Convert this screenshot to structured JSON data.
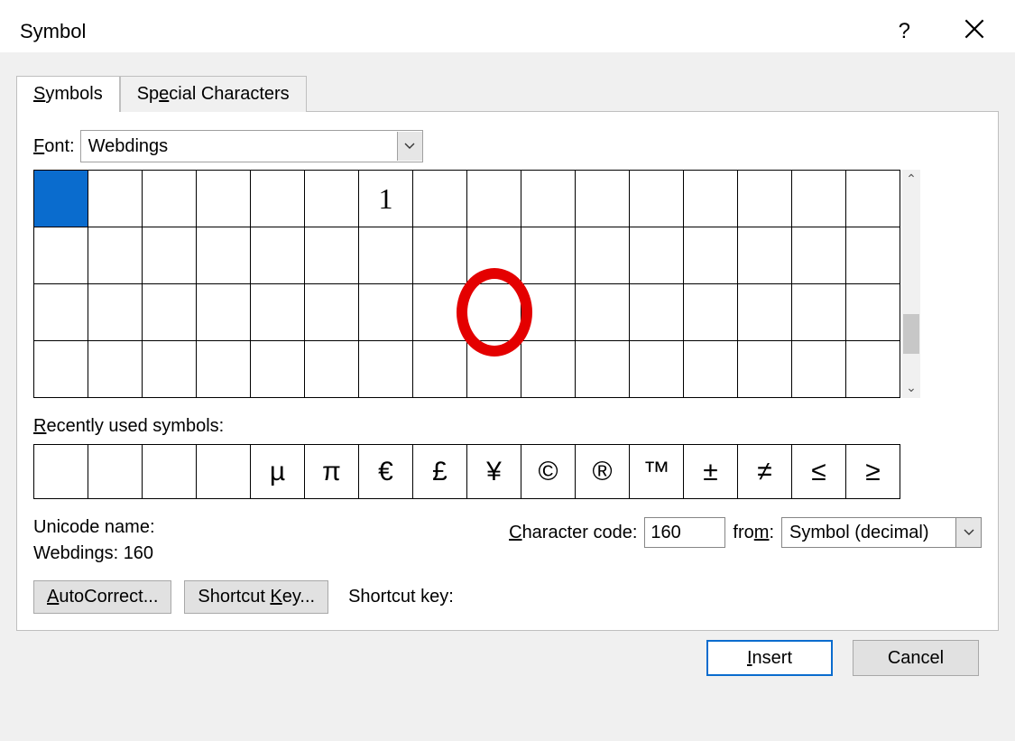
{
  "title": "Symbol",
  "titlebar": {
    "help": "?",
    "close": "×"
  },
  "tabs": {
    "symbols": "Symbols",
    "special": "Special Characters"
  },
  "font": {
    "label": "Font:",
    "value": "Webdings"
  },
  "grid": {
    "rows": [
      [
        "",
        "",
        "",
        "",
        "",
        "",
        "1",
        "",
        "",
        "",
        "",
        "",
        "",
        "",
        "",
        ""
      ],
      [
        "",
        "",
        "",
        "",
        "",
        "",
        "",
        "",
        "",
        "",
        "",
        "",
        "",
        "",
        "",
        ""
      ],
      [
        "",
        "",
        "",
        "",
        "",
        "",
        "",
        "",
        "",
        "",
        "",
        "",
        "",
        "",
        "",
        ""
      ],
      [
        "",
        "",
        "",
        "",
        "",
        "",
        "",
        "",
        "",
        "",
        "",
        "",
        "",
        "",
        "",
        ""
      ]
    ],
    "selected": {
      "r": 0,
      "c": 0
    },
    "circled": {
      "r": 2,
      "c": 8
    }
  },
  "recent": {
    "label": "Recently used symbols:",
    "cells": [
      {
        "t": "",
        "cls": "wd"
      },
      {
        "t": "",
        "cls": "wd"
      },
      {
        "t": "",
        "cls": "s"
      },
      {
        "t": "",
        "cls": "wd"
      },
      {
        "t": "µ",
        "cls": "s"
      },
      {
        "t": "π",
        "cls": "s"
      },
      {
        "t": "€",
        "cls": "s"
      },
      {
        "t": "£",
        "cls": "s"
      },
      {
        "t": "¥",
        "cls": "s"
      },
      {
        "t": "©",
        "cls": "s"
      },
      {
        "t": "®",
        "cls": "s"
      },
      {
        "t": "™",
        "cls": "s"
      },
      {
        "t": "±",
        "cls": "s"
      },
      {
        "t": "≠",
        "cls": "s"
      },
      {
        "t": "≤",
        "cls": "s"
      },
      {
        "t": "≥",
        "cls": "s"
      }
    ]
  },
  "unicode": {
    "label": "Unicode name:",
    "value": "Webdings: 160"
  },
  "cc": {
    "label": "Character code:",
    "value": "160",
    "from_label": "from:",
    "from_value": "Symbol (decimal)"
  },
  "buttons": {
    "autocorrect": "AutoCorrect...",
    "shortcutkey_btn": "Shortcut Key...",
    "shortcutkey_label": "Shortcut key:",
    "insert": "Insert",
    "cancel": "Cancel"
  }
}
